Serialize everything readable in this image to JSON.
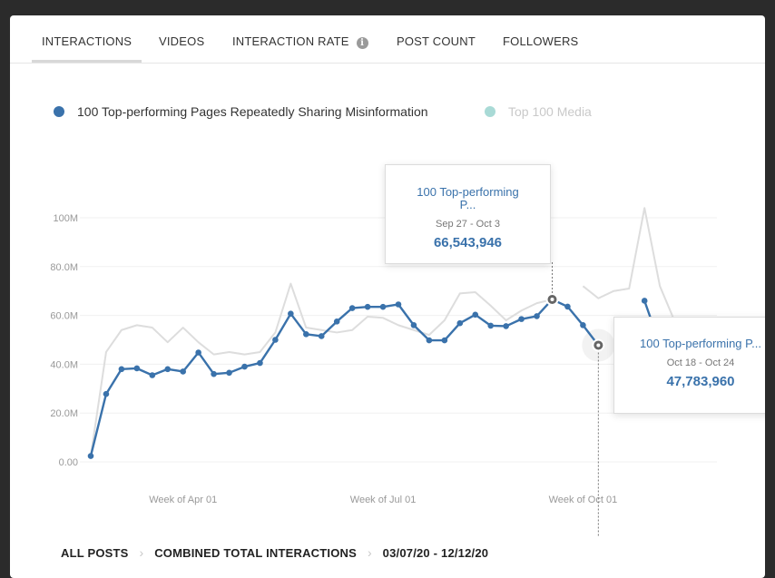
{
  "tabs": [
    {
      "label": "INTERACTIONS",
      "active": true
    },
    {
      "label": "VIDEOS",
      "active": false
    },
    {
      "label": "INTERACTION RATE",
      "active": false,
      "icon": "info-icon"
    },
    {
      "label": "POST COUNT",
      "active": false
    },
    {
      "label": "FOLLOWERS",
      "active": false
    }
  ],
  "colors": {
    "primary_series": "#3a72ab",
    "secondary_series": "#a9dad6",
    "secondary_line": "#dddddd",
    "tooltip_text": "#3a72ab"
  },
  "chart_data": {
    "type": "line",
    "y_tick_labels": [
      "0.00",
      "20.0M",
      "40.0M",
      "60.0M",
      "80.0M",
      "100M"
    ],
    "y_ticks": [
      0,
      20000000,
      40000000,
      60000000,
      80000000,
      100000000
    ],
    "ylim": [
      0,
      110000000
    ],
    "x_tick_labels": [
      "Week of Apr 01",
      "Week of Jul 01",
      "Week of Oct 01"
    ],
    "x_tick_index": [
      6,
      19,
      32
    ],
    "x_count": 41,
    "legend_position": "top-left",
    "grid": true,
    "series": [
      {
        "name": "100 Top-performing Pages Repeatedly Sharing Misinformation",
        "visible": true,
        "values": [
          2400000,
          27800000,
          38000000,
          38300000,
          35500000,
          38000000,
          37000000,
          44800000,
          36000000,
          36500000,
          39000000,
          40500000,
          50000000,
          60700000,
          52300000,
          51500000,
          57500000,
          63000000,
          63500000,
          63500000,
          64500000,
          56000000,
          49800000,
          49800000,
          56800000,
          60300000,
          55800000,
          55600000,
          58500000,
          59700000,
          66543946,
          63600000,
          56000000,
          47783960,
          null,
          null,
          66000000,
          48000000,
          null,
          null,
          null
        ]
      },
      {
        "name": "Top 100 Media",
        "visible": false,
        "values": [
          2400000,
          45000000,
          54000000,
          56000000,
          55000000,
          49000000,
          55000000,
          49000000,
          44000000,
          45000000,
          44000000,
          45000000,
          53000000,
          73000000,
          55000000,
          54000000,
          53000000,
          54000000,
          59500000,
          59000000,
          56000000,
          54000000,
          52000000,
          58000000,
          69000000,
          69500000,
          64000000,
          58000000,
          62000000,
          65000000,
          66543946,
          null,
          72000000,
          67000000,
          70000000,
          71000000,
          104000000,
          72000000,
          57000000,
          null,
          null
        ]
      }
    ]
  },
  "tooltips": [
    {
      "series": "100 Top-performing P...",
      "date": "Sep 27 - Oct 3",
      "value": "66,543,946",
      "index": 30
    },
    {
      "series": "100 Top-performing P...",
      "date": "Oct 18 - Oct 24",
      "value": "47,783,960",
      "index": 33
    }
  ],
  "breadcrumb": [
    "ALL POSTS",
    "COMBINED TOTAL INTERACTIONS",
    "03/07/20 - 12/12/20"
  ]
}
